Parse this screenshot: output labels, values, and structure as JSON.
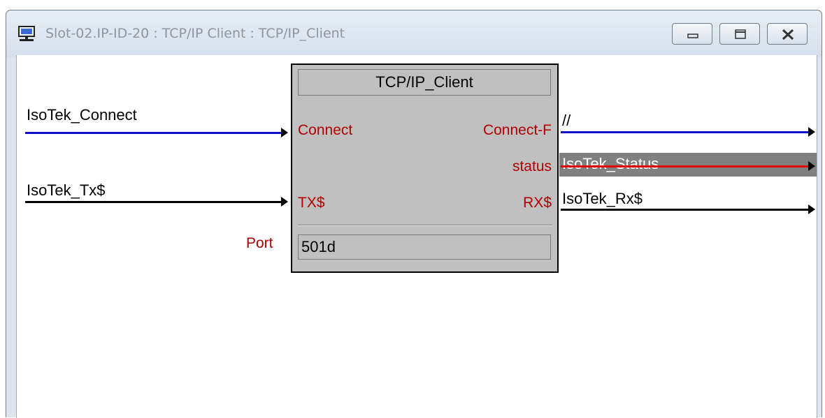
{
  "window": {
    "title": "Slot-02.IP-ID-20 : TCP/IP Client : TCP/IP_Client",
    "controls": {
      "minimize_icon": "minimize-icon",
      "maximize_icon": "maximize-icon",
      "close_icon": "close-icon"
    }
  },
  "block": {
    "title": "TCP/IP_Client",
    "inputs": {
      "connect": "Connect",
      "tx": "TX$"
    },
    "outputs": {
      "connect_f": "Connect-F",
      "status": "status",
      "rx": "RX$"
    },
    "param_label": "Port",
    "param_value": "501d"
  },
  "signals": {
    "input_connect": "IsoTek_Connect",
    "input_tx": "IsoTek_Tx$",
    "output_connect_f": "//",
    "output_status": "IsoTek_Status",
    "output_rx": "IsoTek_Rx$"
  },
  "colors": {
    "digital_wire": "#1010c8",
    "serial_wire": "#000000",
    "analog_wire": "#e00000",
    "pin_label": "#b00000",
    "block_bg": "#c0c0c0"
  }
}
